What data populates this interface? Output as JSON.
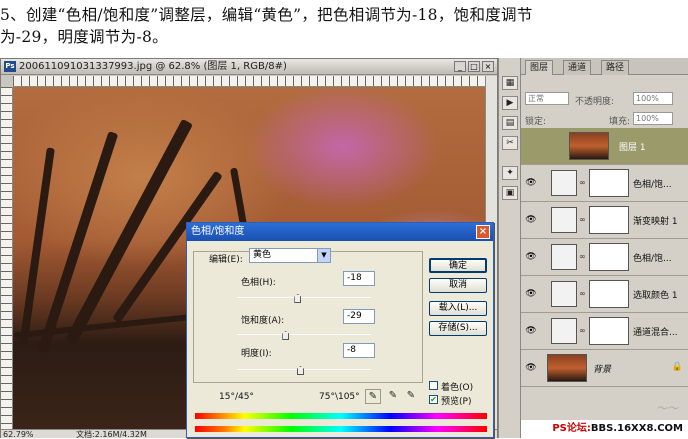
{
  "instruction": {
    "line1": "5、创建“色相/饱和度”调整层，编辑“黄色”，把色相调节为-18，饱和度调节",
    "line2": "为-29，明度调节为-8。"
  },
  "document": {
    "title": "20061109103133​7993.jpg @ 62.8% (图层 1, RGB/8#)",
    "status_zoom": "62.79%",
    "status_doc": "文档:2.16M/4.32M"
  },
  "dialog": {
    "title": "色相/饱和度",
    "edit_label": "编辑(E):",
    "edit_value": "黄色",
    "hue_label": "色相(H):",
    "hue_value": "-18",
    "saturation_label": "饱和度(A):",
    "saturation_value": "-29",
    "lightness_label": "明度(I):",
    "lightness_value": "-8",
    "range_left": "15°/45°",
    "range_right": "75°\\105°",
    "ok_label": "确定",
    "cancel_label": "取消",
    "load_label": "载入(L)...",
    "save_label": "存储(S)...",
    "colorize_label": "着色(O)",
    "preview_label": "预览(P)",
    "colorize_checked": false,
    "preview_checked": true,
    "hue_slider": 0.45,
    "saturation_slider": 0.36,
    "lightness_slider": 0.47
  },
  "panel": {
    "tabs": [
      "图层",
      "通道",
      "路径"
    ],
    "blend_mode": "正常",
    "opacity_label": "不透明度:",
    "opacity_value": "100%",
    "lock_label": "锁定:",
    "fill_label": "填充:",
    "fill_value": "100%",
    "layers": [
      {
        "name": "图层 1",
        "type": "image",
        "selected": true
      },
      {
        "name": "色相/饱...",
        "type": "adjust"
      },
      {
        "name": "渐变映射 1",
        "type": "adjust"
      },
      {
        "name": "色相/饱...",
        "type": "adjust"
      },
      {
        "name": "选取颜色 1",
        "type": "adjust"
      },
      {
        "name": "通道混合...",
        "type": "adjust"
      },
      {
        "name": "背景",
        "type": "background"
      }
    ],
    "footer_text_red": "PS论坛:",
    "footer_text": "BBS.16XX8.COM"
  }
}
